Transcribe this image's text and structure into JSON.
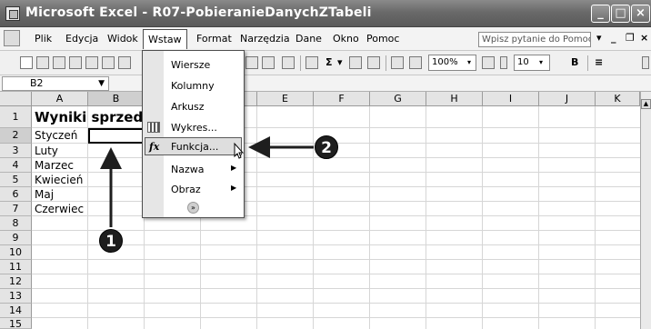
{
  "window": {
    "title": "Microsoft Excel - R07-PobieranieDanychZTabeli",
    "minimize": "_",
    "maximize": "□",
    "close": "×"
  },
  "menubar": {
    "items": [
      "Plik",
      "Edycja",
      "Widok",
      "Wstaw",
      "Format",
      "Narzędzia",
      "Dane",
      "Okno",
      "Pomoc"
    ],
    "help_placeholder": "Wpisz pytanie do Pomocy"
  },
  "toolbar": {
    "zoom": "100%",
    "font_size": "10",
    "bold": "B"
  },
  "formula_bar": {
    "name_box": "B2"
  },
  "columns": [
    "A",
    "B",
    "C",
    "D",
    "E",
    "F",
    "G",
    "H",
    "I",
    "J",
    "K"
  ],
  "rows": [
    "1",
    "2",
    "3",
    "4",
    "5",
    "6",
    "7",
    "8",
    "9",
    "10",
    "11",
    "12",
    "13",
    "14",
    "15"
  ],
  "cells": {
    "a1": "Wyniki sprzedaż",
    "a2": "Styczeń",
    "a3": "Luty",
    "a4": "Marzec",
    "a5": "Kwiecień",
    "a6": "Maj",
    "a7": "Czerwiec"
  },
  "insert_menu": {
    "items": [
      "Wiersze",
      "Kolumny",
      "Arkusz",
      "Wykres...",
      "Funkcja...",
      "Nazwa",
      "Obraz"
    ],
    "highlighted": "Funkcja..."
  },
  "callouts": [
    "1",
    "2"
  ]
}
